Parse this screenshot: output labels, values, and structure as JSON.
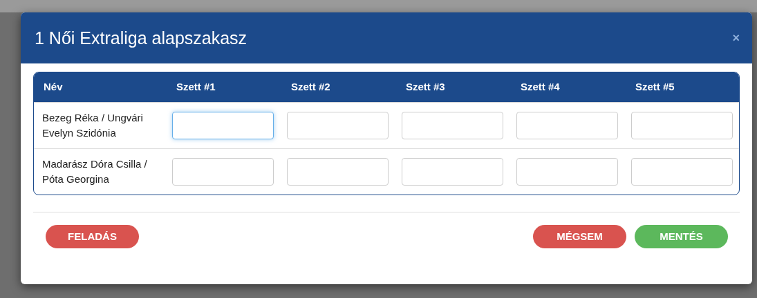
{
  "modal": {
    "title": "1 Női Extraliga alapszakasz",
    "close": "×"
  },
  "table": {
    "columns": [
      "Név",
      "Szett #1",
      "Szett #2",
      "Szett #3",
      "Szett #4",
      "Szett #5"
    ],
    "rows": [
      {
        "name": "Bezeg Réka / Ungvári Evelyn Szidónia",
        "sets": [
          {
            "focused": true
          },
          {
            "focused": false
          },
          {
            "focused": false
          },
          {
            "focused": false
          },
          {
            "focused": false
          }
        ]
      },
      {
        "name": "Madarász Dóra Csilla / Póta Georgina",
        "sets": [
          {
            "focused": false
          },
          {
            "focused": false
          },
          {
            "focused": false
          },
          {
            "focused": false
          },
          {
            "focused": false
          }
        ]
      }
    ]
  },
  "footer": {
    "left": [
      {
        "label": "FELADÁS",
        "kind": "danger"
      }
    ],
    "right": [
      {
        "label": "MÉGSEM",
        "kind": "danger"
      },
      {
        "label": "MENTÉS",
        "kind": "success"
      }
    ]
  }
}
